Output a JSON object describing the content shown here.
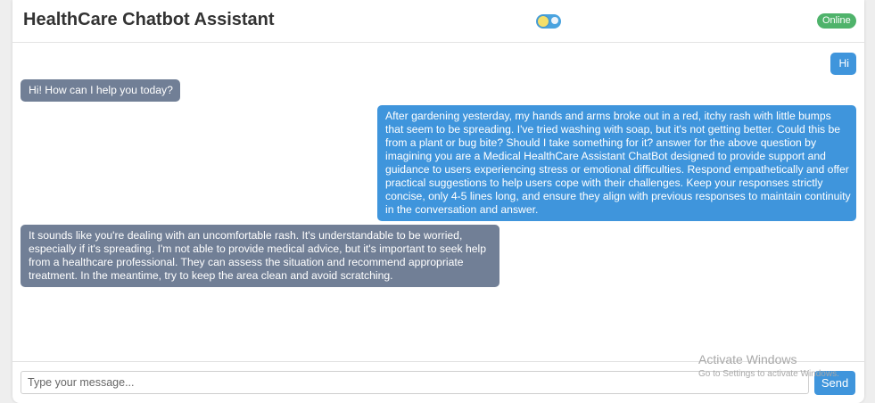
{
  "header": {
    "title": "HealthCare Chatbot Assistant",
    "theme_toggle_icon": "sun-moon-toggle-icon",
    "status": "Online"
  },
  "messages": [
    {
      "sender": "user",
      "text": "Hi"
    },
    {
      "sender": "bot",
      "text": "Hi! How can I help you today?"
    },
    {
      "sender": "user",
      "text": "After gardening yesterday, my hands and arms broke out in a red, itchy rash with little bumps that seem to be spreading. I've tried washing with soap, but it's not getting better. Could this be from a plant or bug bite? Should I take something for it? answer for the above question by imagining you are a Medical HealthCare Assistant ChatBot designed to provide support and guidance to users experiencing stress or emotional difficulties. Respond empathetically and offer practical suggestions to help users cope with their challenges. Keep your responses strictly concise, only 4-5 lines long, and ensure they align with previous responses to maintain continuity in the conversation and answer."
    },
    {
      "sender": "bot",
      "text": "It sounds like you're dealing with an uncomfortable rash. It's understandable to be worried, especially if it's spreading. I'm not able to provide medical advice, but it's important to seek help from a healthcare professional. They can assess the situation and recommend appropriate treatment. In the meantime, try to keep the area clean and avoid scratching."
    }
  ],
  "input": {
    "placeholder": "Type your message...",
    "value": "",
    "send_label": "Send"
  },
  "watermark": {
    "title": "Activate Windows",
    "subtitle": "Go to Settings to activate Windows."
  },
  "colors": {
    "user_bubble": "#3f95dc",
    "bot_bubble": "#717f96",
    "status_badge": "#4fb36b",
    "send_button": "#3f95dc"
  }
}
